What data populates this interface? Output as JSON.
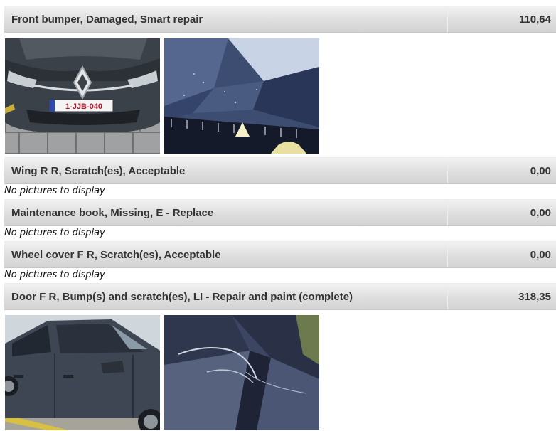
{
  "items": [
    {
      "label": "Front bumper, Damaged, Smart repair",
      "amount": "110,64"
    },
    {
      "label": "Wing R R, Scratch(es), Acceptable",
      "amount": "0,00"
    },
    {
      "label": "Maintenance book, Missing, E - Replace",
      "amount": "0,00"
    },
    {
      "label": "Wheel cover F R, Scratch(es), Acceptable",
      "amount": "0,00"
    },
    {
      "label": "Door F R, Bump(s) and scratch(es), LI - Repair and paint (complete)",
      "amount": "318,35"
    }
  ],
  "no_pictures_text": "No pictures to display",
  "photo_text": {
    "license_plate": "1-JJB-040"
  }
}
